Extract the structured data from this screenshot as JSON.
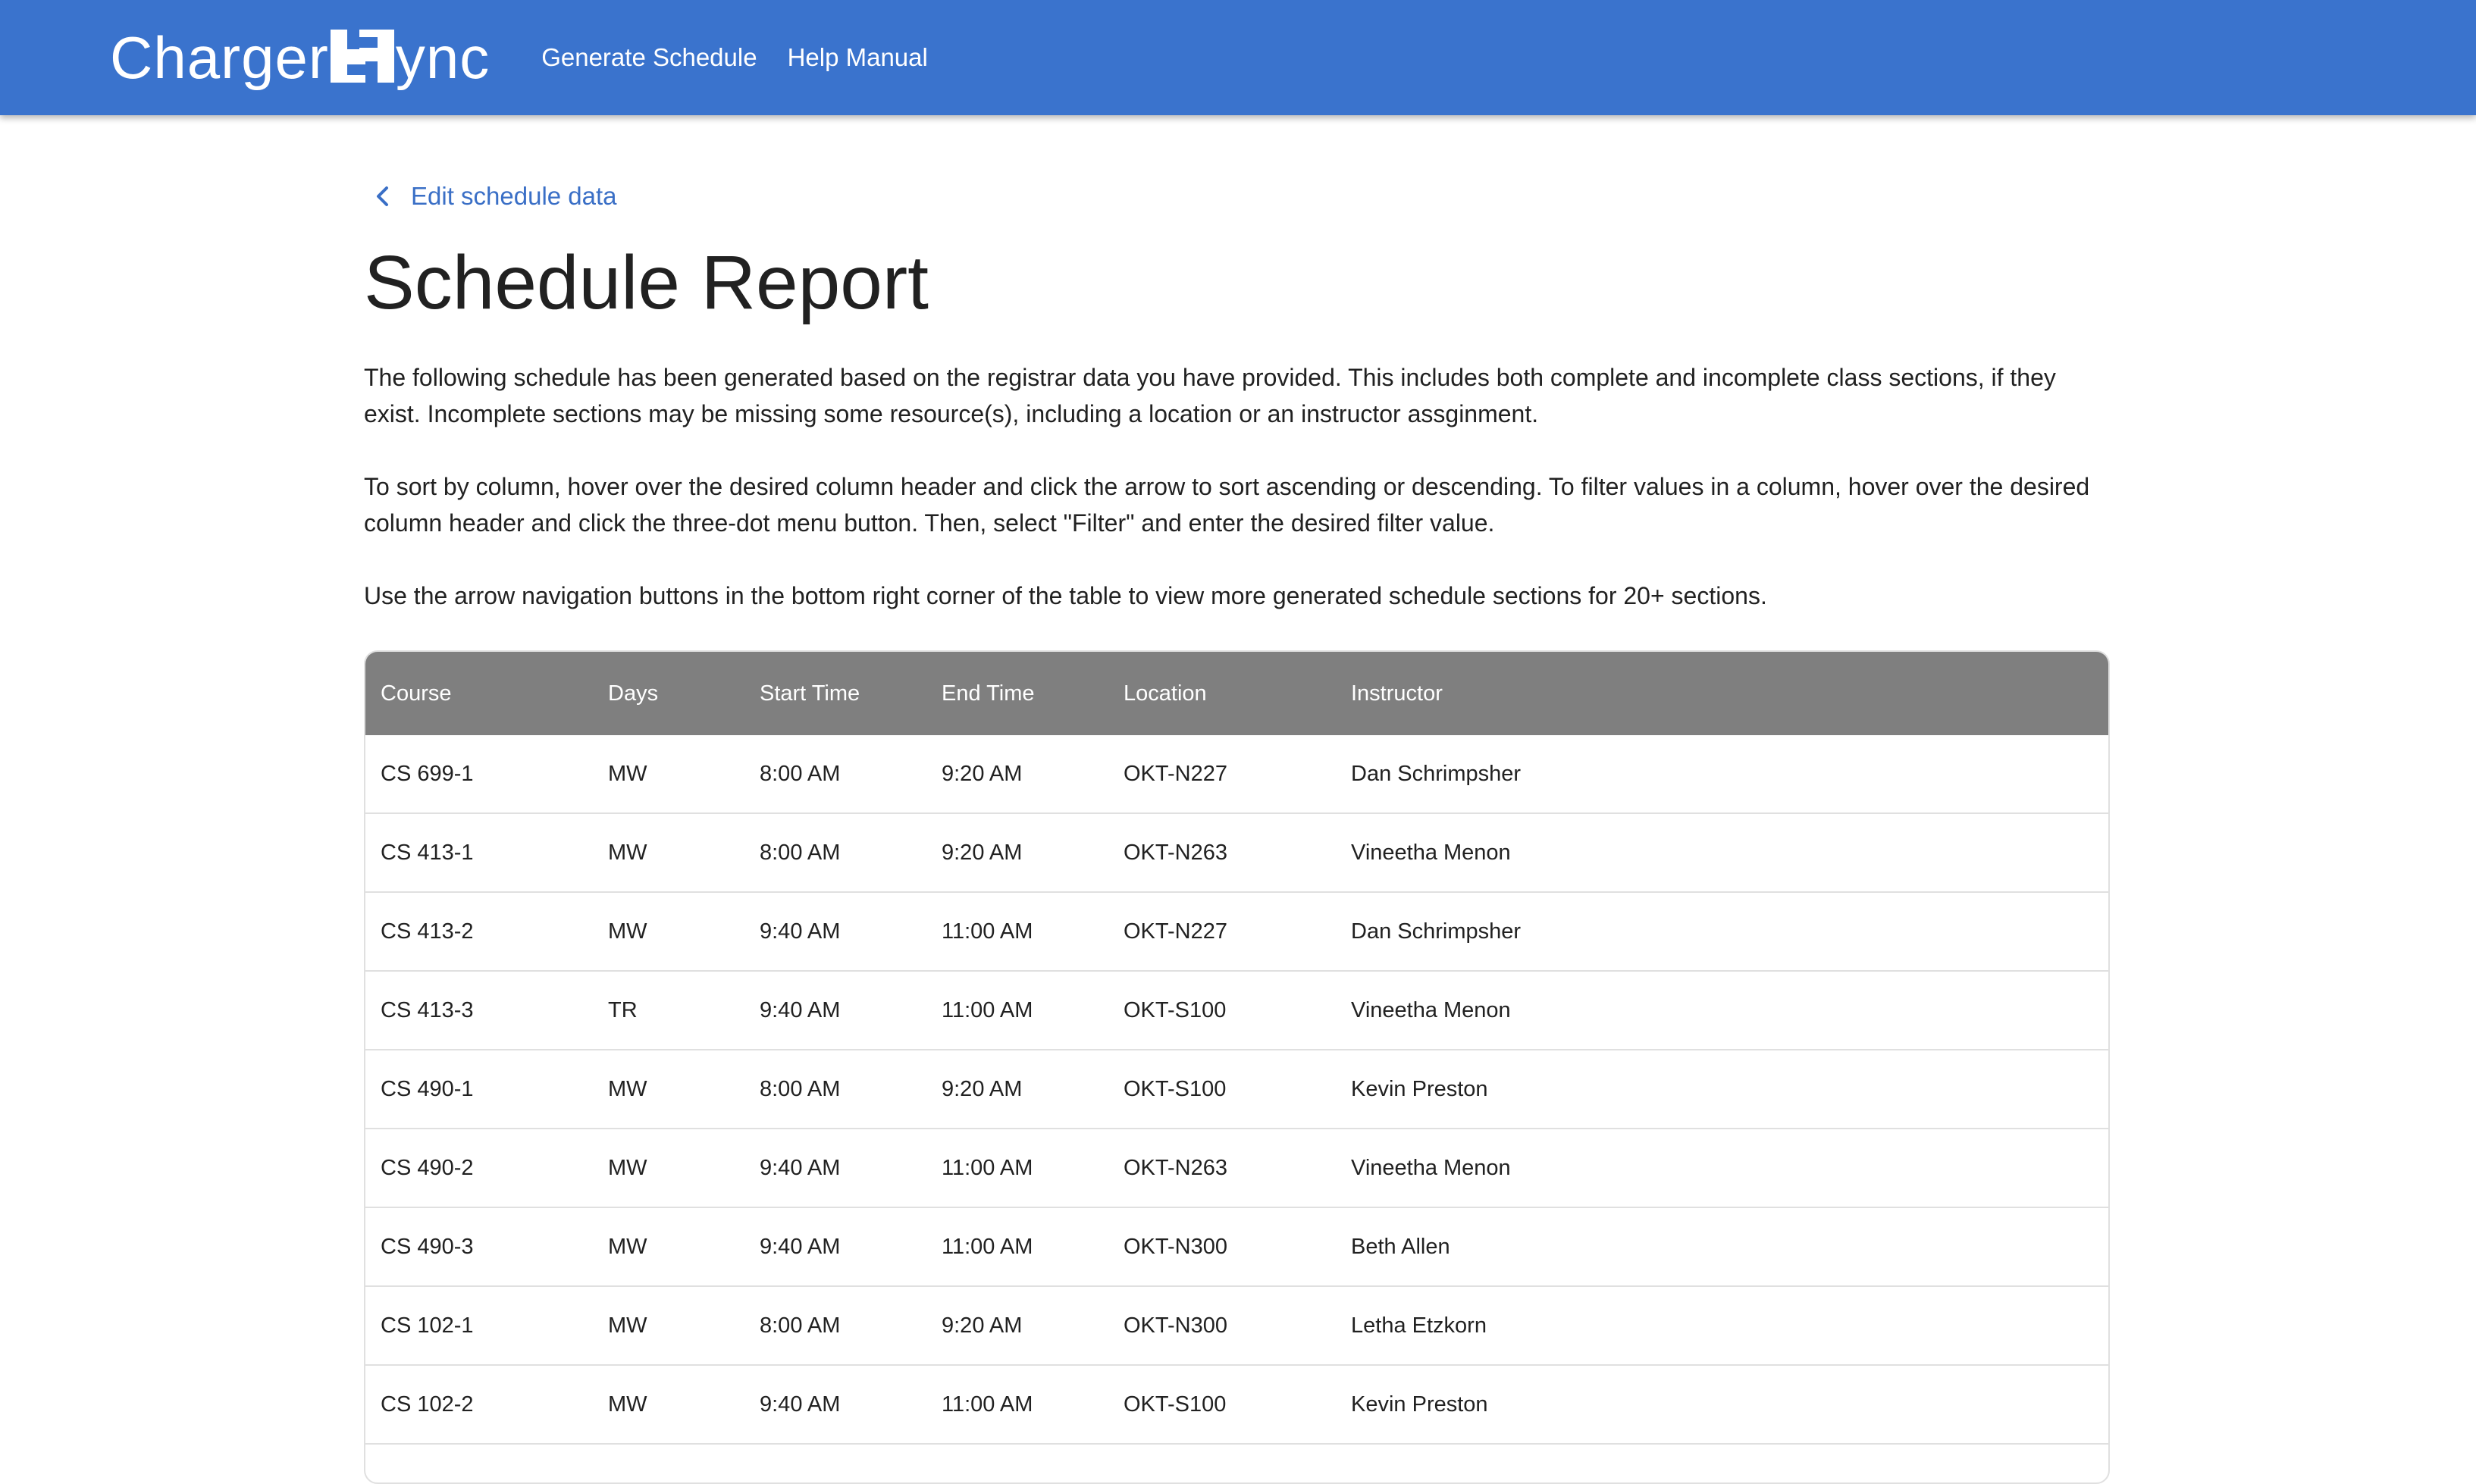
{
  "app": {
    "logo_text_left": "Charger",
    "logo_text_right": "ync",
    "brand_color": "#3a73cd"
  },
  "nav": {
    "items": [
      {
        "label": "Generate Schedule"
      },
      {
        "label": "Help Manual"
      }
    ]
  },
  "page": {
    "back_link": "Edit schedule data",
    "title": "Schedule Report",
    "paragraphs": [
      "The following schedule has been generated based on the registrar data you have provided. This includes both complete and incomplete class sections, if they exist. Incomplete sections may be missing some resource(s), including a location or an instructor assginment.",
      "To sort by column, hover over the desired column header and click the arrow to sort ascending or descending. To filter values in a column, hover over the desired column header and click the three-dot menu button. Then, select \"Filter\" and enter the desired filter value.",
      "Use the arrow navigation buttons in the bottom right corner of the table to view more generated schedule sections for 20+ sections."
    ]
  },
  "table": {
    "columns": [
      "Course",
      "Days",
      "Start Time",
      "End Time",
      "Location",
      "Instructor"
    ],
    "rows": [
      [
        "CS 699-1",
        "MW",
        "8:00 AM",
        "9:20 AM",
        "OKT-N227",
        "Dan Schrimpsher"
      ],
      [
        "CS 413-1",
        "MW",
        "8:00 AM",
        "9:20 AM",
        "OKT-N263",
        "Vineetha Menon"
      ],
      [
        "CS 413-2",
        "MW",
        "9:40 AM",
        "11:00 AM",
        "OKT-N227",
        "Dan Schrimpsher"
      ],
      [
        "CS 413-3",
        "TR",
        "9:40 AM",
        "11:00 AM",
        "OKT-S100",
        "Vineetha Menon"
      ],
      [
        "CS 490-1",
        "MW",
        "8:00 AM",
        "9:20 AM",
        "OKT-S100",
        "Kevin Preston"
      ],
      [
        "CS 490-2",
        "MW",
        "9:40 AM",
        "11:00 AM",
        "OKT-N263",
        "Vineetha Menon"
      ],
      [
        "CS 490-3",
        "MW",
        "9:40 AM",
        "11:00 AM",
        "OKT-N300",
        "Beth Allen"
      ],
      [
        "CS 102-1",
        "MW",
        "8:00 AM",
        "9:20 AM",
        "OKT-N300",
        "Letha Etzkorn"
      ],
      [
        "CS 102-2",
        "MW",
        "9:40 AM",
        "11:00 AM",
        "OKT-S100",
        "Kevin Preston"
      ]
    ]
  }
}
